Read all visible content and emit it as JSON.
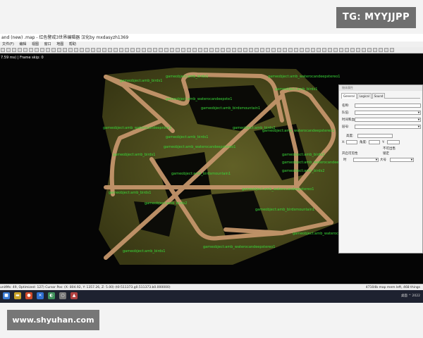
{
  "watermark_top": "TG: MYYJJPP",
  "watermark_bottom": "www.shyuhan.com",
  "window": {
    "title": "and (new) .map - 红色警戒3世界编辑器 汉化by mxdasyzh1369",
    "menu": [
      "文件(F)",
      "编辑",
      "视图",
      "窗口",
      "地图",
      "帮助"
    ],
    "fps_text": "7.59 ms) | Frame skip: 0"
  },
  "map_objects": [
    "gameobject:amb_birds1",
    "gameobject:amb_waterocandeepstereo1",
    "gameobject:amb_birds1",
    "gameobject:amb_waterocandeepste1",
    "gameobject:amb_birds1",
    "gameobject:amb_birdsmountain1",
    "gameobject:amb_waterocandeepnine1",
    "gameobject:amb_birds2",
    "gameobject:amb_waterocandeepstereo1",
    "gameobject:amb_birds1",
    "gameobject:amb_waterocandeepstereo1",
    "gameobject:amb_birds1",
    "gameobject:amb_birds2",
    "gameobject:amb_waterocandeepstereo1",
    "gameobject:amb_birds2",
    "gameobject:amb_birdsmountain1",
    "gameobject:amb_waterocandeepstereo1",
    "gameobject:amb_birds1",
    "gameobject:amb_birds2",
    "gameobject:amb_birdsmountain1",
    "gameobject:amb_waterocandeepstereo1",
    "gameobject:amb_birds1",
    "gameobject:amb_waterocandeepstereo1"
  ],
  "properties_panel": {
    "title": "物体属性",
    "tabs": [
      "General",
      "Logical",
      "Sound"
    ],
    "active_tab": "General",
    "fields": {
      "name_label": "名称:",
      "team_label": "队伍:",
      "time_label": "时间和血",
      "layer_label": "层号:",
      "height_label": "高度:",
      "x_label": "X:",
      "angle_label": "角度:",
      "y_label": "Y:",
      "unsellable_label": "不可出售",
      "enabled_label": "开启可见性",
      "lock_label": "锁定",
      "heal_label": "时",
      "size_label": "大号"
    }
  },
  "status_bar": {
    "left": "unitMs: 49, Optimized: 127) Cursor Pos: (X: 804.92, Y: 1357.26, Z: 5.00) (t0:511373.g0.511373.b0.000000)",
    "right": "47104b map mem left, 468 things"
  },
  "taskbar": {
    "tray_text": "桌面 ^ 2022"
  }
}
